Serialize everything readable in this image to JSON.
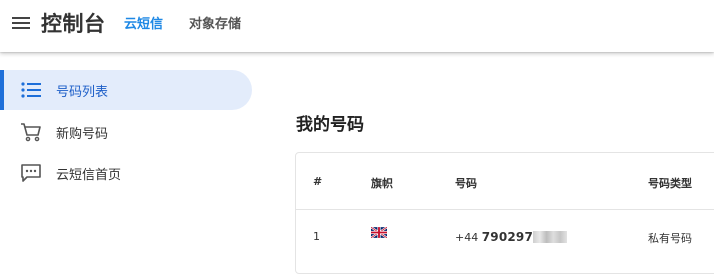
{
  "header": {
    "title": "控制台",
    "nav": [
      {
        "label": "云短信",
        "active": true
      },
      {
        "label": "对象存储",
        "active": false
      }
    ]
  },
  "sidebar": {
    "items": [
      {
        "label": "号码列表",
        "icon": "list-icon",
        "active": true
      },
      {
        "label": "新购号码",
        "icon": "cart-icon",
        "active": false
      },
      {
        "label": "云短信首页",
        "icon": "message-icon",
        "active": false
      }
    ]
  },
  "main": {
    "title": "我的号码",
    "table": {
      "columns": [
        "#",
        "旗帜",
        "号码",
        "号码类型"
      ],
      "rows": [
        {
          "index": "1",
          "flag": "uk-flag-icon",
          "country_code": "+44",
          "number_visible": "790297",
          "type": "私有号码"
        }
      ]
    }
  },
  "colors": {
    "accent": "#1e88e5",
    "active_bg": "#e3ecfb",
    "active_bar": "#1e6fd9"
  }
}
